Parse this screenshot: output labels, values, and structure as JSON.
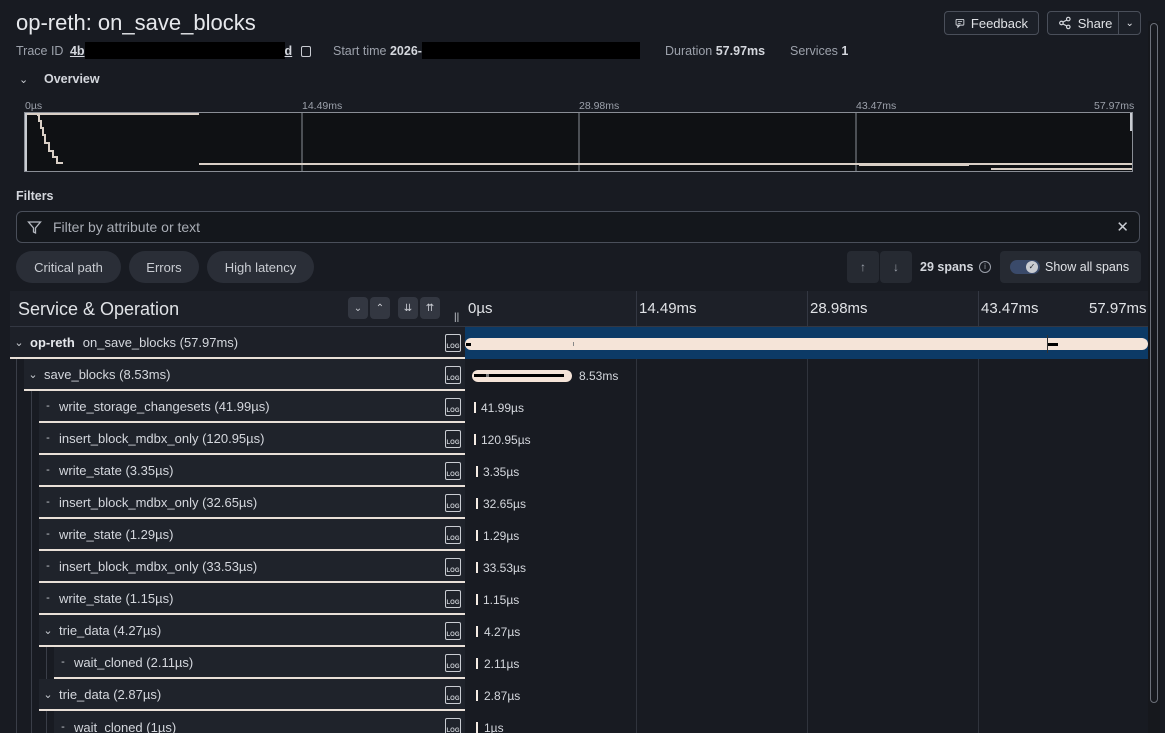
{
  "header": {
    "title": "op-reth: on_save_blocks",
    "feedback_label": "Feedback",
    "share_label": "Share"
  },
  "meta": {
    "trace_id_label": "Trace ID",
    "trace_id_start": "4b",
    "trace_id_end": "d",
    "start_time_label": "Start time",
    "start_time_value": "2026-",
    "duration_label": "Duration",
    "duration_value": "57.97ms",
    "services_label": "Services",
    "services_value": "1"
  },
  "overview": {
    "label": "Overview",
    "ticks": [
      "0µs",
      "14.49ms",
      "28.98ms",
      "43.47ms",
      "57.97ms"
    ]
  },
  "filters": {
    "label": "Filters",
    "placeholder": "Filter by attribute or text",
    "chips": [
      "Critical path",
      "Errors",
      "High latency"
    ],
    "span_count": "29 spans",
    "show_all_label": "Show all spans"
  },
  "timeline": {
    "header_label": "Service & Operation",
    "ticks": [
      "0µs",
      "14.49ms",
      "28.98ms",
      "43.47ms",
      "57.97ms"
    ],
    "root": {
      "service": "op-reth",
      "operation": "on_save_blocks (57.97ms)"
    },
    "rows": [
      {
        "label": "save_blocks (8.53ms)",
        "duration": "8.53ms"
      },
      {
        "label": "write_storage_changesets (41.99µs)",
        "duration": "41.99µs"
      },
      {
        "label": "insert_block_mdbx_only (120.95µs)",
        "duration": "120.95µs"
      },
      {
        "label": "write_state (3.35µs)",
        "duration": "3.35µs"
      },
      {
        "label": "insert_block_mdbx_only (32.65µs)",
        "duration": "32.65µs"
      },
      {
        "label": "write_state (1.29µs)",
        "duration": "1.29µs"
      },
      {
        "label": "insert_block_mdbx_only (33.53µs)",
        "duration": "33.53µs"
      },
      {
        "label": "write_state (1.15µs)",
        "duration": "1.15µs"
      },
      {
        "label": "trie_data (4.27µs)",
        "duration": "4.27µs"
      },
      {
        "label": "wait_cloned (2.11µs)",
        "duration": "2.11µs"
      },
      {
        "label": "trie_data (2.87µs)",
        "duration": "2.87µs"
      },
      {
        "label": "wait_cloned (1µs)",
        "duration": "1µs"
      }
    ],
    "log_icon_text": "LOG"
  }
}
